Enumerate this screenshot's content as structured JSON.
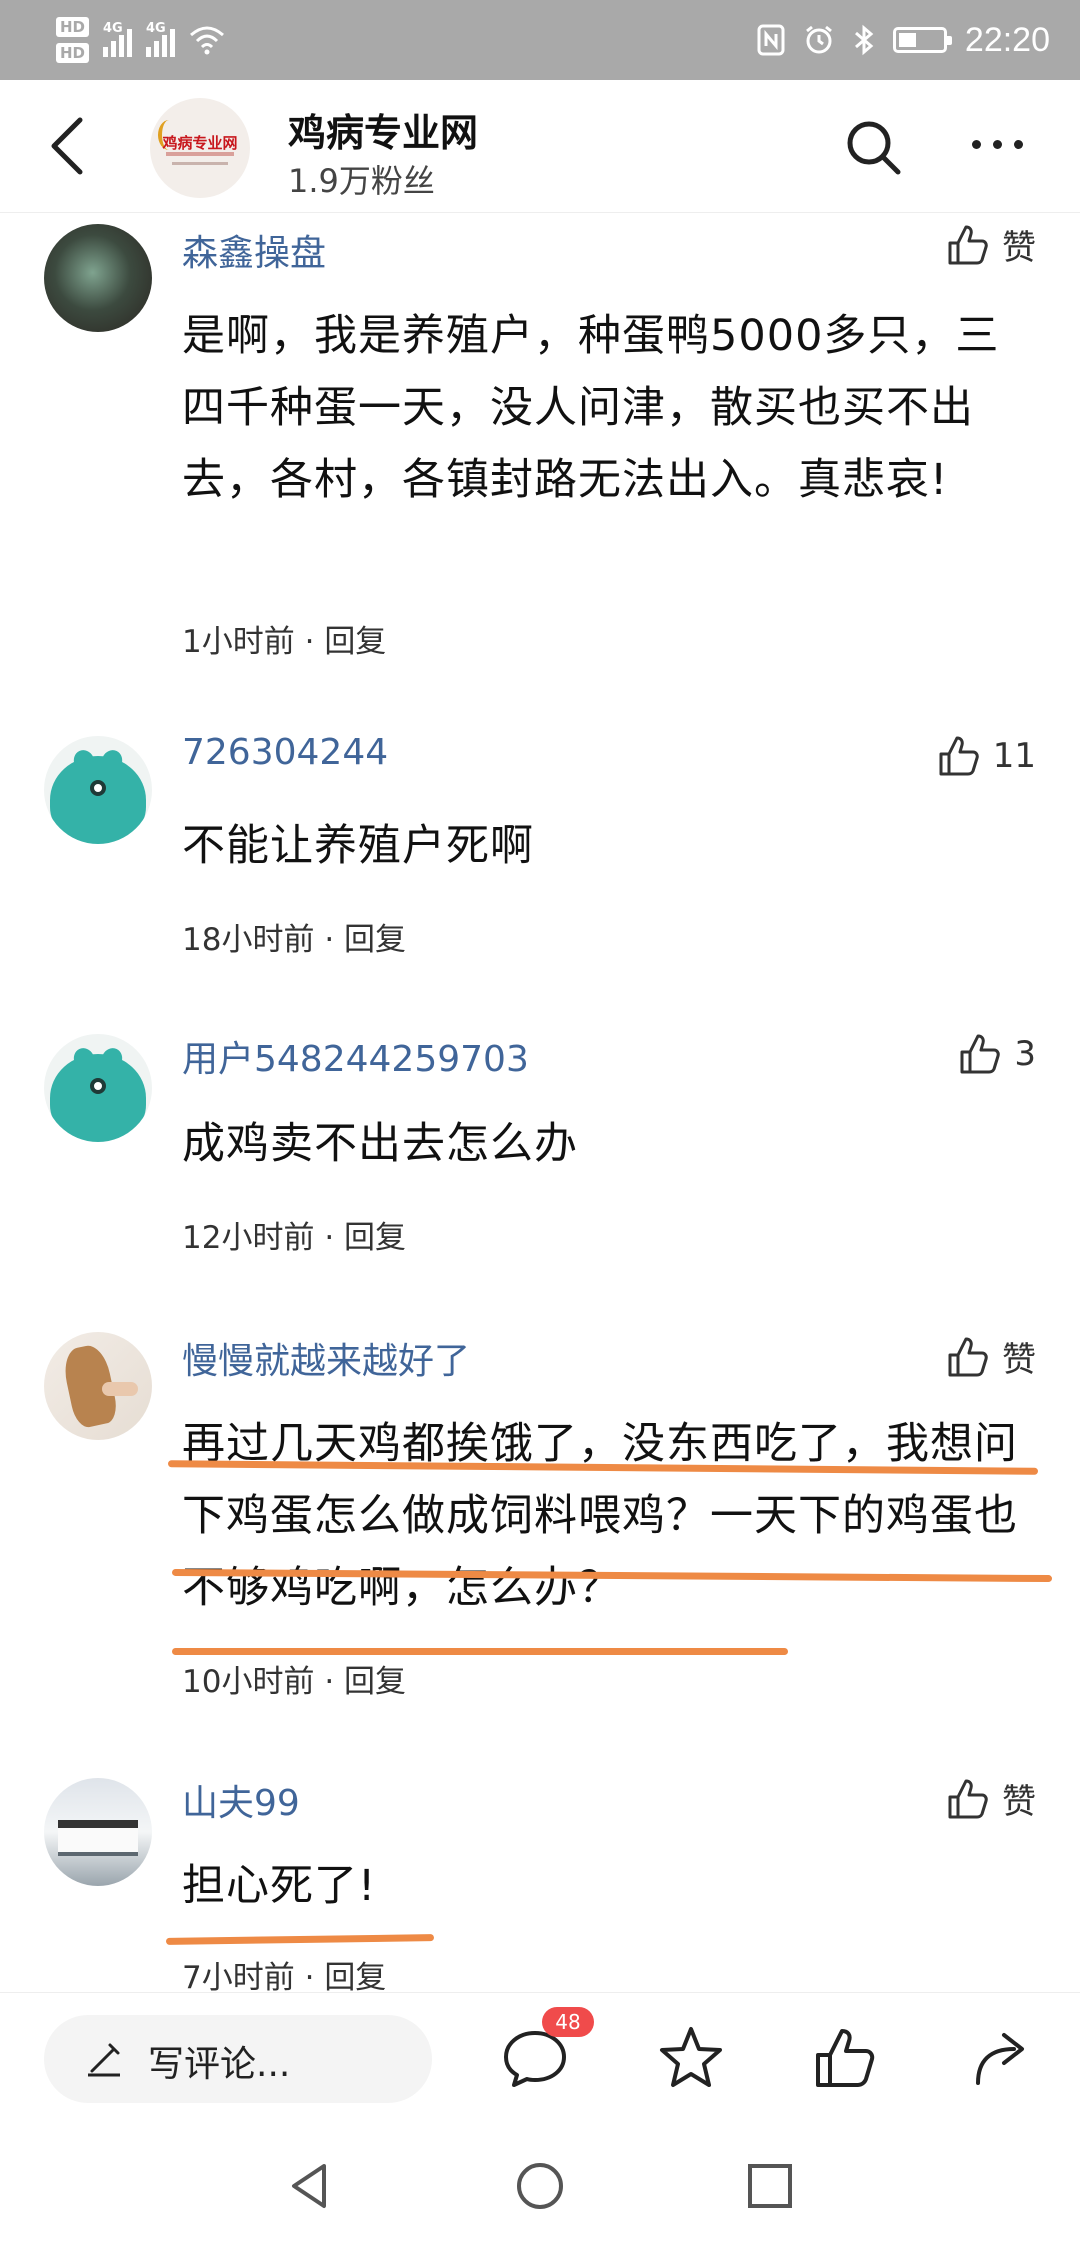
{
  "status_bar": {
    "sim1": "HD",
    "sim2": "HD",
    "net1": "4G",
    "net2": "4G",
    "time": "22:20",
    "battery_level": 0.4
  },
  "header": {
    "account_name": "鸡病专业网",
    "fans": "1.9万粉丝",
    "logo_text": "鸡病专业网"
  },
  "comments": [
    {
      "user": "森鑫操盘",
      "like": "赞",
      "text": "是啊，我是养殖户，种蛋鸭5000多只，三四千种蛋一天，没人问津，散买也买不出去，各村，各镇封路无法出入。真悲哀!",
      "time": "1小时前",
      "reply": "回复",
      "sep": "·"
    },
    {
      "user": "726304244",
      "like": "11",
      "text": "不能让养殖户死啊",
      "time": "18小时前",
      "reply": "回复",
      "sep": "·"
    },
    {
      "user": "用户548244259703",
      "like": "3",
      "text": "成鸡卖不出去怎么办",
      "time": "12小时前",
      "reply": "回复",
      "sep": "·"
    },
    {
      "user": "慢慢就越来越好了",
      "like": "赞",
      "text": "再过几天鸡都挨饿了，没东西吃了，我想问下鸡蛋怎么做成饲料喂鸡？一天下的鸡蛋也不够鸡吃啊，怎么办？",
      "time": "10小时前",
      "reply": "回复",
      "sep": "·"
    },
    {
      "user": "山夫99",
      "like": "赞",
      "text": "担心死了!",
      "time": "7小时前",
      "reply": "回复",
      "sep": "·"
    }
  ],
  "bottom_bar": {
    "write_placeholder": "写评论...",
    "comment_count": "48"
  },
  "colors": {
    "username": "#406599",
    "highlight_underline": "#ee8a45",
    "badge": "#f04b4b",
    "status_bar": "#a9a9a9"
  }
}
